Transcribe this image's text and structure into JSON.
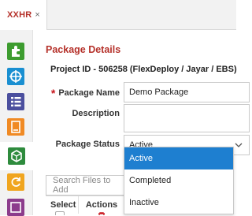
{
  "tab": {
    "label": "XXHR",
    "close": "×"
  },
  "rail": {
    "items": [
      {
        "icon": "puzzle-icon",
        "color": "#3d9c2f"
      },
      {
        "icon": "network-icon",
        "color": "#1a8fd1"
      },
      {
        "icon": "list-icon",
        "color": "#4b4f9e"
      },
      {
        "icon": "document-icon",
        "color": "#f08a24"
      },
      {
        "icon": "cube-icon",
        "color": "#2e8b3d"
      },
      {
        "icon": "refresh-icon",
        "color": "#f0a51f"
      },
      {
        "icon": "app-icon",
        "color": "#8c3c8c"
      }
    ]
  },
  "form": {
    "title": "Package Details",
    "project_id": "Project ID - 506258 (FlexDeploy / Jayar / EBS)",
    "package_name_label": "Package Name",
    "required_mark": "*",
    "package_name_value": "Demo Package",
    "description_label": "Description",
    "description_value": "",
    "status_label": "Package Status",
    "status_value": "Active"
  },
  "status_options": [
    "Active",
    "Completed",
    "Inactive"
  ],
  "search": {
    "placeholder": "Search Files to Add"
  },
  "table": {
    "columns": [
      "Select",
      "Actions"
    ]
  },
  "colors": {
    "accent": "#b5312a",
    "selected": "#1e7fd0"
  }
}
